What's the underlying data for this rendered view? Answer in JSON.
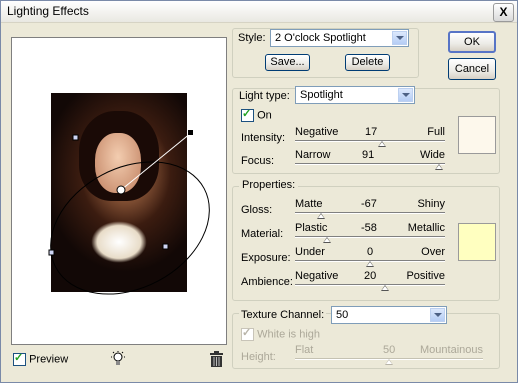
{
  "window": {
    "title": "Lighting Effects",
    "close_glyph": "X"
  },
  "style": {
    "label": "Style:",
    "value": "2 O'clock Spotlight",
    "save_label": "Save...",
    "delete_label": "Delete"
  },
  "buttons": {
    "ok_label": "OK",
    "cancel_label": "Cancel"
  },
  "light_type": {
    "label": "Light type:",
    "value": "Spotlight",
    "on_label": "On",
    "on_checked": true
  },
  "intensity": {
    "label": "Intensity:",
    "min_label": "Negative",
    "value": "17",
    "max_label": "Full",
    "level": 0.58
  },
  "focus": {
    "label": "Focus:",
    "min_label": "Narrow",
    "value": "91",
    "max_label": "Wide",
    "level": 0.96
  },
  "light_color": "#fdf8ec",
  "properties": {
    "title": "Properties:",
    "gloss": {
      "label": "Gloss:",
      "min_label": "Matte",
      "value": "-67",
      "max_label": "Shiny",
      "level": 0.17
    },
    "material": {
      "label": "Material:",
      "min_label": "Plastic",
      "value": "-58",
      "max_label": "Metallic",
      "level": 0.21
    },
    "exposure": {
      "label": "Exposure:",
      "min_label": "Under",
      "value": "0",
      "max_label": "Over",
      "level": 0.5
    },
    "ambience": {
      "label": "Ambience:",
      "min_label": "Negative",
      "value": "20",
      "max_label": "Positive",
      "level": 0.6
    },
    "ambient_color": "#ffffc0"
  },
  "texture": {
    "label": "Texture Channel:",
    "value": "50",
    "white_is_high_label": "White is high",
    "height_label": "Height:",
    "min_label": "Flat",
    "max_label": "Mountainous",
    "level": 0.5
  },
  "preview": {
    "label": "Preview",
    "checked": true,
    "bulb_icon": "light-bulb-icon",
    "trash_icon": "trash-icon"
  }
}
